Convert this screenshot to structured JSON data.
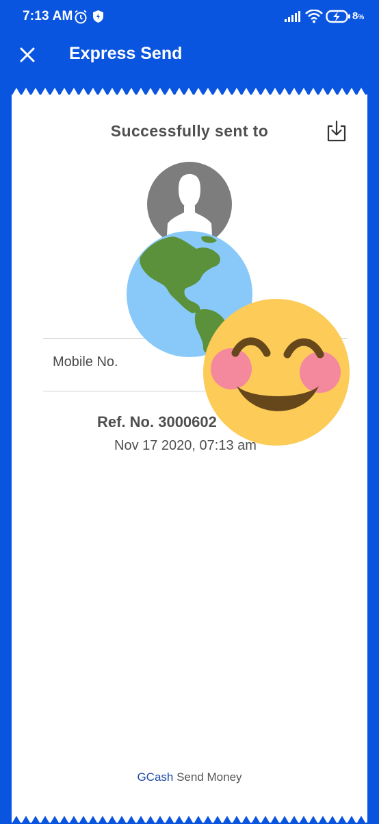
{
  "status_bar": {
    "time": "7:13 AM",
    "battery_text": "8",
    "icons": [
      "alarm-icon",
      "shield-icon",
      "signal-icon",
      "wifi-icon",
      "battery-charging-icon"
    ]
  },
  "app_bar": {
    "title": "Express Send",
    "close_icon": "close-icon"
  },
  "receipt": {
    "heading": "Successfully sent to",
    "download_icon": "download-icon",
    "mobile_label": "Mobile No.",
    "ref_no": "Ref. No. 3000602",
    "date": "Nov 17 2020, 07:13 am",
    "footer_brand": "GCash",
    "footer_text": "Send Money"
  },
  "overlays": [
    "globe-emoji",
    "smiling-emoji"
  ],
  "colors": {
    "brand_blue": "#0a55e0",
    "card": "#ffffff",
    "text": "#4f4f4f",
    "avatar": "#7d7d7d"
  }
}
